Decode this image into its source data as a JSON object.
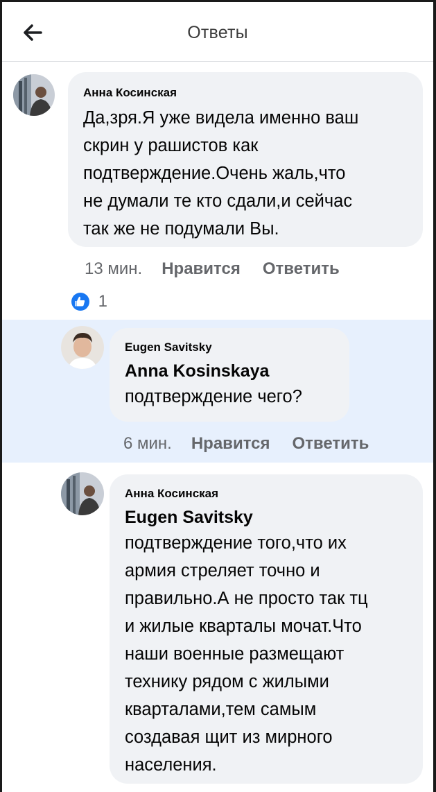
{
  "header": {
    "title": "Ответы"
  },
  "comments": [
    {
      "author": "Анна Косинская",
      "text": "Да,зря.Я уже видела именно ваш скрин у рашистов как подтверждение.Очень жаль,что не думали те кто сдали,и сейчас так же не подумали Вы.",
      "lines": [
        "Да,зря.Я уже видела именно ваш",
        "скрин у рашистов как",
        "подтверждение.Очень жаль,что",
        "не думали те кто сдали,и сейчас",
        "так же не подумали Вы."
      ],
      "time": "13 мин.",
      "like_label": "Нравится",
      "reply_label": "Ответить",
      "reaction_count": "1"
    },
    {
      "author": "Eugen Savitsky",
      "mention": "Anna Kosinskaya",
      "lines": [
        "подтверждение чего?"
      ],
      "time": "6 мин.",
      "like_label": "Нравится",
      "reply_label": "Ответить",
      "highlighted": true
    },
    {
      "author": "Анна Косинская",
      "mention": "Eugen Savitsky",
      "lines": [
        "подтверждение того,что их",
        "армия стреляет точно и",
        "правильно.А не просто так тц",
        "и жилые кварталы мочат.Что",
        "наши военные размещают",
        "технику рядом с жилыми",
        "кварталами,тем самым",
        "создавая щит из мирного",
        "населения."
      ]
    }
  ],
  "colors": {
    "highlight": "#e7f0fd",
    "bubble": "#f0f2f5",
    "like": "#1877f2",
    "meta": "#65676b"
  },
  "icons": {
    "back": "arrow-left-icon",
    "reaction": "thumbs-up-icon"
  }
}
